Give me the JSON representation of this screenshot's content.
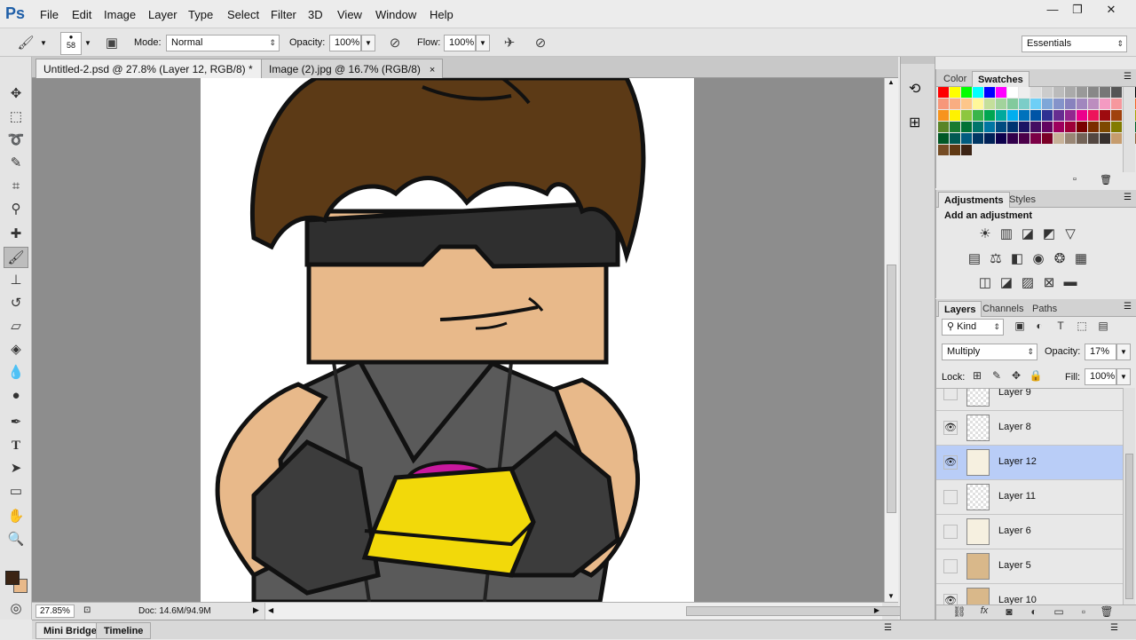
{
  "app": {
    "logo": "Ps",
    "window_buttons": [
      "—",
      "❐",
      "✕"
    ]
  },
  "menu": [
    "File",
    "Edit",
    "Image",
    "Layer",
    "Type",
    "Select",
    "Filter",
    "3D",
    "View",
    "Window",
    "Help"
  ],
  "options": {
    "brush_size": "58",
    "mode_label": "Mode:",
    "mode_value": "Normal",
    "opacity_label": "Opacity:",
    "opacity_value": "100%",
    "flow_label": "Flow:",
    "flow_value": "100%",
    "workspace": "Essentials"
  },
  "tabs": [
    {
      "label": "Untitled-2.psd @ 27.8% (Layer 12, RGB/8) *",
      "close": "×"
    },
    {
      "label": "Image (2).jpg @ 16.7% (RGB/8)",
      "close": "×"
    }
  ],
  "status": {
    "zoom": "27.85%",
    "doc": "Doc: 14.6M/94.9M"
  },
  "bottom_tabs": [
    "Mini Bridge",
    "Timeline"
  ],
  "color_panel": {
    "tabs": [
      "Color",
      "Swatches"
    ]
  },
  "adjustments": {
    "tabs": [
      "Adjustments",
      "Styles"
    ],
    "heading": "Add an adjustment"
  },
  "layers_panel": {
    "tabs": [
      "Layers",
      "Channels",
      "Paths"
    ],
    "filter_kind": "Kind",
    "blend_mode": "Multiply",
    "opacity_label": "Opacity:",
    "opacity_value": "17%",
    "lock_label": "Lock:",
    "fill_label": "Fill:",
    "fill_value": "100%",
    "layers": [
      {
        "name": "Layer 9",
        "visible": false
      },
      {
        "name": "Layer 8",
        "visible": true
      },
      {
        "name": "Layer 12",
        "visible": true,
        "selected": true
      },
      {
        "name": "Layer 11",
        "visible": false
      },
      {
        "name": "Layer 6",
        "visible": false
      },
      {
        "name": "Layer 5",
        "visible": false
      },
      {
        "name": "Layer 10",
        "visible": true
      }
    ]
  },
  "colors": {
    "foreground": "#3b2414",
    "background": "#e8b98a",
    "selection": "#b9cdf7"
  }
}
